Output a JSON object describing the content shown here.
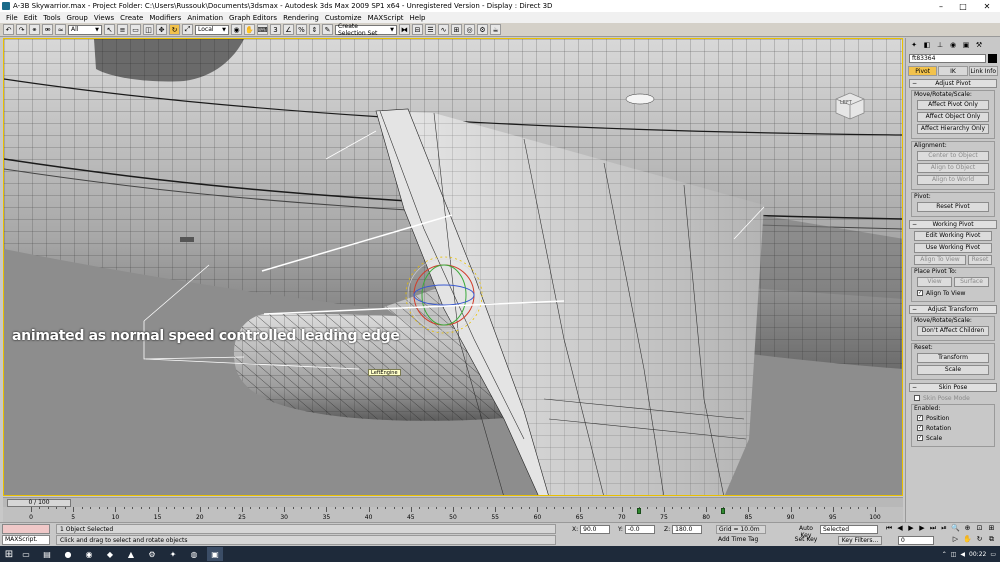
{
  "window": {
    "title": "A-3B Skywarrior.max   - Project Folder: C:\\Users\\Russouk\\Documents\\3dsmax     - Autodesk 3ds Max  2009 SP1  x64   - Unregistered Version     - Display : Direct 3D",
    "min": "–",
    "max": "□",
    "close": "✕"
  },
  "menu": [
    "File",
    "Edit",
    "Tools",
    "Group",
    "Views",
    "Create",
    "Modifiers",
    "Animation",
    "Graph Editors",
    "Rendering",
    "Customize",
    "MAXScript",
    "Help"
  ],
  "toolbar": {
    "selection_filter": "All",
    "ref_coord": "Local",
    "named_selection": "Create Selection Set"
  },
  "viewport": {
    "annotation": "animated as normal speed controlled leading edge",
    "object_tooltip": "LeftEngine",
    "viewcube_label": "LEFT"
  },
  "command_panel": {
    "object_name": "ft83364",
    "hierarchy_tabs": [
      "Pivot",
      "IK",
      "Link Info"
    ],
    "adjust_pivot": {
      "title": "Adjust Pivot",
      "move_group": "Move/Rotate/Scale:",
      "affect_pivot": "Affect Pivot Only",
      "affect_object": "Affect Object Only",
      "affect_hierarchy": "Affect Hierarchy Only",
      "alignment_group": "Alignment:",
      "center_to_object": "Center to Object",
      "align_to_object": "Align to Object",
      "align_to_world": "Align to World",
      "pivot_group": "Pivot:",
      "reset_pivot": "Reset Pivot"
    },
    "working_pivot": {
      "title": "Working Pivot",
      "edit": "Edit Working Pivot",
      "use": "Use Working Pivot",
      "align_to_view": "Align To View",
      "reset": "Reset",
      "place_group": "Place Pivot To:",
      "view": "View",
      "surface": "Surface",
      "align_to_view_chk": "Align To View"
    },
    "adjust_transform": {
      "title": "Adjust Transform",
      "move_group": "Move/Rotate/Scale:",
      "dont_affect": "Don't Affect Children",
      "reset_group": "Reset:",
      "transform": "Transform",
      "scale": "Scale"
    },
    "skin_pose": {
      "title": "Skin Pose",
      "skin_pose_mode": "Skin Pose Mode",
      "enabled_group": "Enabled:",
      "position": "Position",
      "rotation": "Rotation",
      "scale": "Scale"
    }
  },
  "timeline": {
    "slider": "0 / 100",
    "ticks": [
      "0",
      "5",
      "10",
      "15",
      "20",
      "25",
      "30",
      "35",
      "40",
      "45",
      "50",
      "55",
      "60",
      "65",
      "70",
      "75",
      "80",
      "85",
      "90",
      "95",
      "100"
    ],
    "keys": [
      72,
      82
    ]
  },
  "status": {
    "maxscript": "MAXScript.",
    "selected": "1 Object Selected",
    "prompt": "Click and drag to select and rotate objects",
    "x_label": "X:",
    "x_value": "90.0",
    "y_label": "Y:",
    "y_value": "-0.0",
    "z_label": "Z:",
    "z_value": "180.0",
    "grid": "Grid = 10.0m",
    "add_time_tag": "Add Time Tag",
    "auto_key": "Auto Key",
    "set_key": "Set Key",
    "selected_dropdown": "Selected",
    "key_filters": "Key Filters...",
    "frame": "0"
  },
  "taskbar": {
    "time": "00:22"
  }
}
